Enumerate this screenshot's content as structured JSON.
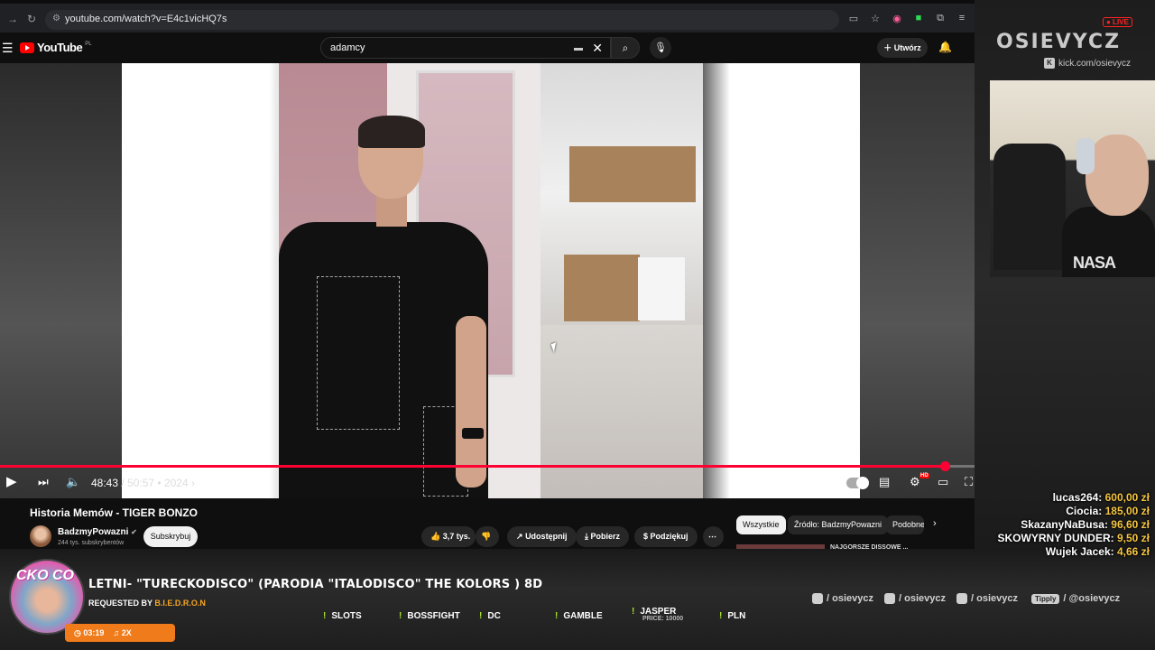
{
  "browser": {
    "url": "youtube.com/watch?v=E4c1vicHQ7s"
  },
  "youtube": {
    "logo_text": "YouTube",
    "logo_region": "PL",
    "search_query": "adamcy",
    "create_label": "Utwórz"
  },
  "player": {
    "current_time": "48:43",
    "separator": " / ",
    "duration": "50:57",
    "chapter": " • 2024 ›",
    "progress_fraction": 0.969
  },
  "video": {
    "title": "Historia Memów - TIGER BONZO",
    "channel": "BadzmyPowazni",
    "subscribers": "244 tys. subskrybentów",
    "subscribe_label": "Subskrybuj",
    "likes": "3,7 tys.",
    "share_label": "Udostępnij",
    "download_label": "Pobierz",
    "thanks_label": "Podziękuj"
  },
  "chips": [
    {
      "label": "Wszystkie"
    },
    {
      "label": "Źródło: BadzmyPowazni"
    },
    {
      "label": "Podobne"
    }
  ],
  "recommendation": {
    "title": "NAJGORSZE DISSOWE ..."
  },
  "stream": {
    "live": "● LIVE",
    "brand": "OSIEVYCZ",
    "kick": "kick.com/osievycz",
    "webcam_shirt": "NASA",
    "donations": [
      {
        "name": "lucas264:",
        "amount": "600,00 zł"
      },
      {
        "name": "Ciocia:",
        "amount": "185,00 zł"
      },
      {
        "name": "SkazanyNaBusa:",
        "amount": "96,60 zł"
      },
      {
        "name": "SKOWYRNY DUNDER:",
        "amount": "9,50 zł"
      },
      {
        "name": "Wujek Jacek:",
        "amount": "4,66 zł"
      }
    ],
    "song": {
      "art_label": "CKO CO",
      "title": "LETNI- \"TURECKODISCO\" (PARODIA \"ITALODISCO\" THE KOLORS ) 8D",
      "requested_prefix": "REQUESTED BY",
      "requested_by": "B.I.E.D.R.O.N",
      "time": "03:19",
      "plays": "2X"
    },
    "commands": [
      {
        "label": "SLOTS",
        "sub": ""
      },
      {
        "label": "BOSSFIGHT",
        "sub": ""
      },
      {
        "label": "DC",
        "sub": ""
      },
      {
        "label": "GAMBLE",
        "sub": ""
      },
      {
        "label": "JASPER",
        "sub": "PRICE: 10000"
      },
      {
        "label": "PLN",
        "sub": ""
      }
    ],
    "socials": {
      "instagram": "/ osievycz",
      "tiktok": "/ osievycz",
      "youtube": "/ osievycz",
      "tipply_label": "Tipply",
      "tipply": "/ @osievycz"
    }
  },
  "colors": {
    "progress": "#ff0033",
    "accent": "#f07b1a",
    "donation_amount": "#f5c542"
  }
}
